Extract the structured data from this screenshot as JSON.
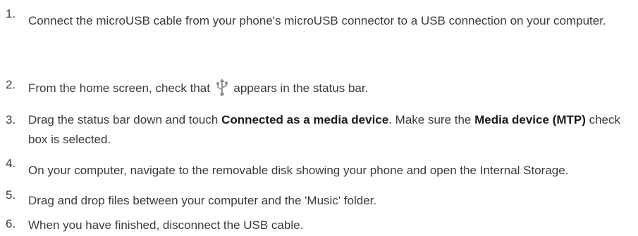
{
  "steps": [
    {
      "number": "1.",
      "text": "Connect the microUSB cable from your phone's microUSB connector to a USB connection on your computer."
    },
    {
      "number": "2.",
      "text_before": "From the home screen, check that ",
      "icon": "usb-icon",
      "text_after": " appears in the status bar."
    },
    {
      "number": "3.",
      "text_part1": "Drag the status bar down and touch ",
      "bold1": "Connected as a media device",
      "text_part2": ". Make sure the ",
      "bold2": "Media device (MTP)",
      "text_part3": " check box is selected."
    },
    {
      "number": "4.",
      "text": "On your computer, navigate to the removable disk showing your phone and open the Internal Storage."
    },
    {
      "number": "5.",
      "text": "Drag and drop files between your computer and the 'Music' folder."
    },
    {
      "number": "6.",
      "text": "When you have finished, disconnect the USB cable."
    }
  ],
  "colors": {
    "text": "#3a3a3a",
    "bold_text": "#1a1a1a",
    "icon": "#8a8a8a"
  }
}
